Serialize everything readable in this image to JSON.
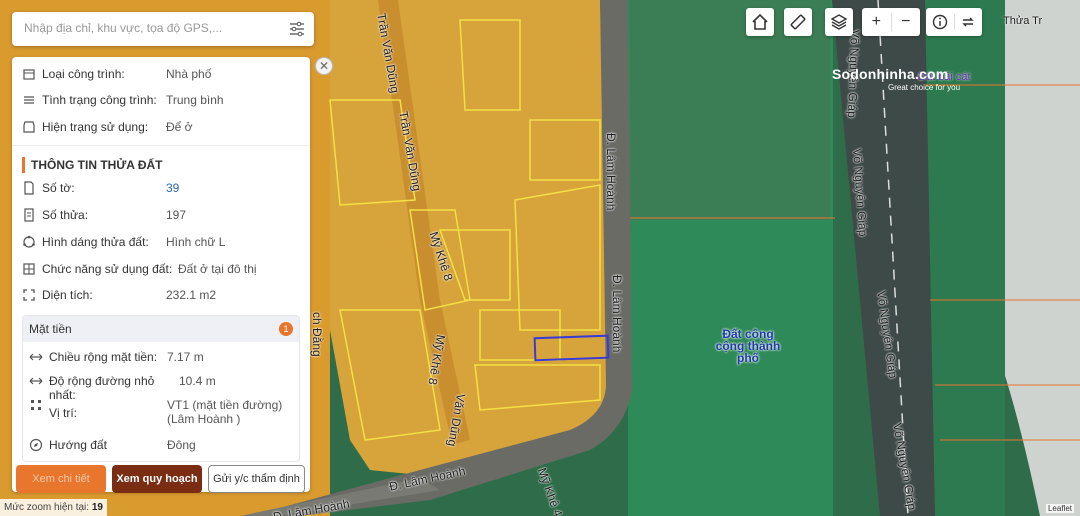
{
  "search": {
    "placeholder": "Nhập địa chỉ, khu vực, tọa độ GPS,..."
  },
  "building": {
    "type_label": "Loại công trình:",
    "type_value": "Nhà phố",
    "condition_label": "Tình trạng công trình:",
    "condition_value": "Trung bình",
    "usage_label": "Hiện trạng sử dụng:",
    "usage_value": "Để ở"
  },
  "parcel": {
    "title": "THÔNG TIN THỬA ĐẤT",
    "sheet_label": "Số tờ:",
    "sheet_value": "39",
    "lot_label": "Số thửa:",
    "lot_value": "197",
    "shape_label": "Hình dáng thửa đất:",
    "shape_value": "Hình chữ L",
    "function_label": "Chức năng sử dụng đất:",
    "function_value": "Đất ở tại đô thị",
    "area_label": "Diện tích:",
    "area_value": "232.1 m2"
  },
  "frontage": {
    "title": "Mặt tiền",
    "count": "1",
    "width_label": "Chiều rộng mặt tiền:",
    "width_value": "7.17 m",
    "road_label": "Độ rộng đường nhỏ nhất:",
    "road_value": "10.4 m",
    "position_label": "Vị trí:",
    "position_value": "VT1 (mặt tiền đường)(Lâm Hoành )",
    "direction_label": "Hướng đất",
    "direction_value": "Đông"
  },
  "actions": {
    "btn1": "Xem chi tiết",
    "btn2": "Xem quy hoạch",
    "btn3": "Gửi y/c thẩm định"
  },
  "zoom": {
    "label": "Mức zoom hiện tại:",
    "value": "19"
  },
  "map": {
    "roads": {
      "tran_van_dung_1": "Trần Văn Dũng",
      "tran_van_dung_2": "Trần Văn Dũng",
      "lam_hoanh_1": "Đ. Lâm Hoành",
      "lam_hoanh_2": "Đ. Lâm Hoành",
      "lam_hoanh_3": "Đ. Lâm Hoành",
      "lam_hoanh_4": "Đ. Lâm Hoành",
      "my_khe_8_1": "Mỹ Khê 8",
      "my_khe_8_2": "Mỹ Khê 8",
      "my_khe_4": "Mỹ Khê 4",
      "vo_nguyen_giap_1": "Võ Nguyên Giáp",
      "vo_nguyen_giap_2": "Võ Nguyên Giáp",
      "vo_nguyen_giap_3": "Võ Nguyên Giáp",
      "vo_nguyen_giap_4": "Võ Nguyên Giáp",
      "tran_van_dung_3": "Văn Dũng",
      "bach_dang": "ch Đằng"
    },
    "zone_label": "Đất công cộng thành phố",
    "zone_color": "#2f8a5a",
    "residential_color": "#e0a83a",
    "parcel_highlight_color": "#3a3ad6",
    "purple_label": "Đất bãi cát",
    "top_right_label": "Thửa Tr"
  },
  "brand": {
    "name": "Sodonhinha.com",
    "tagline": "Great choice for you"
  },
  "toolbar": {
    "home": "home-icon",
    "ruler": "ruler-icon",
    "layers": "layers-icon",
    "zoom_in": "+",
    "zoom_out": "−",
    "info": "info-icon",
    "swap": "swap-icon"
  },
  "attribution": "Leaflet"
}
